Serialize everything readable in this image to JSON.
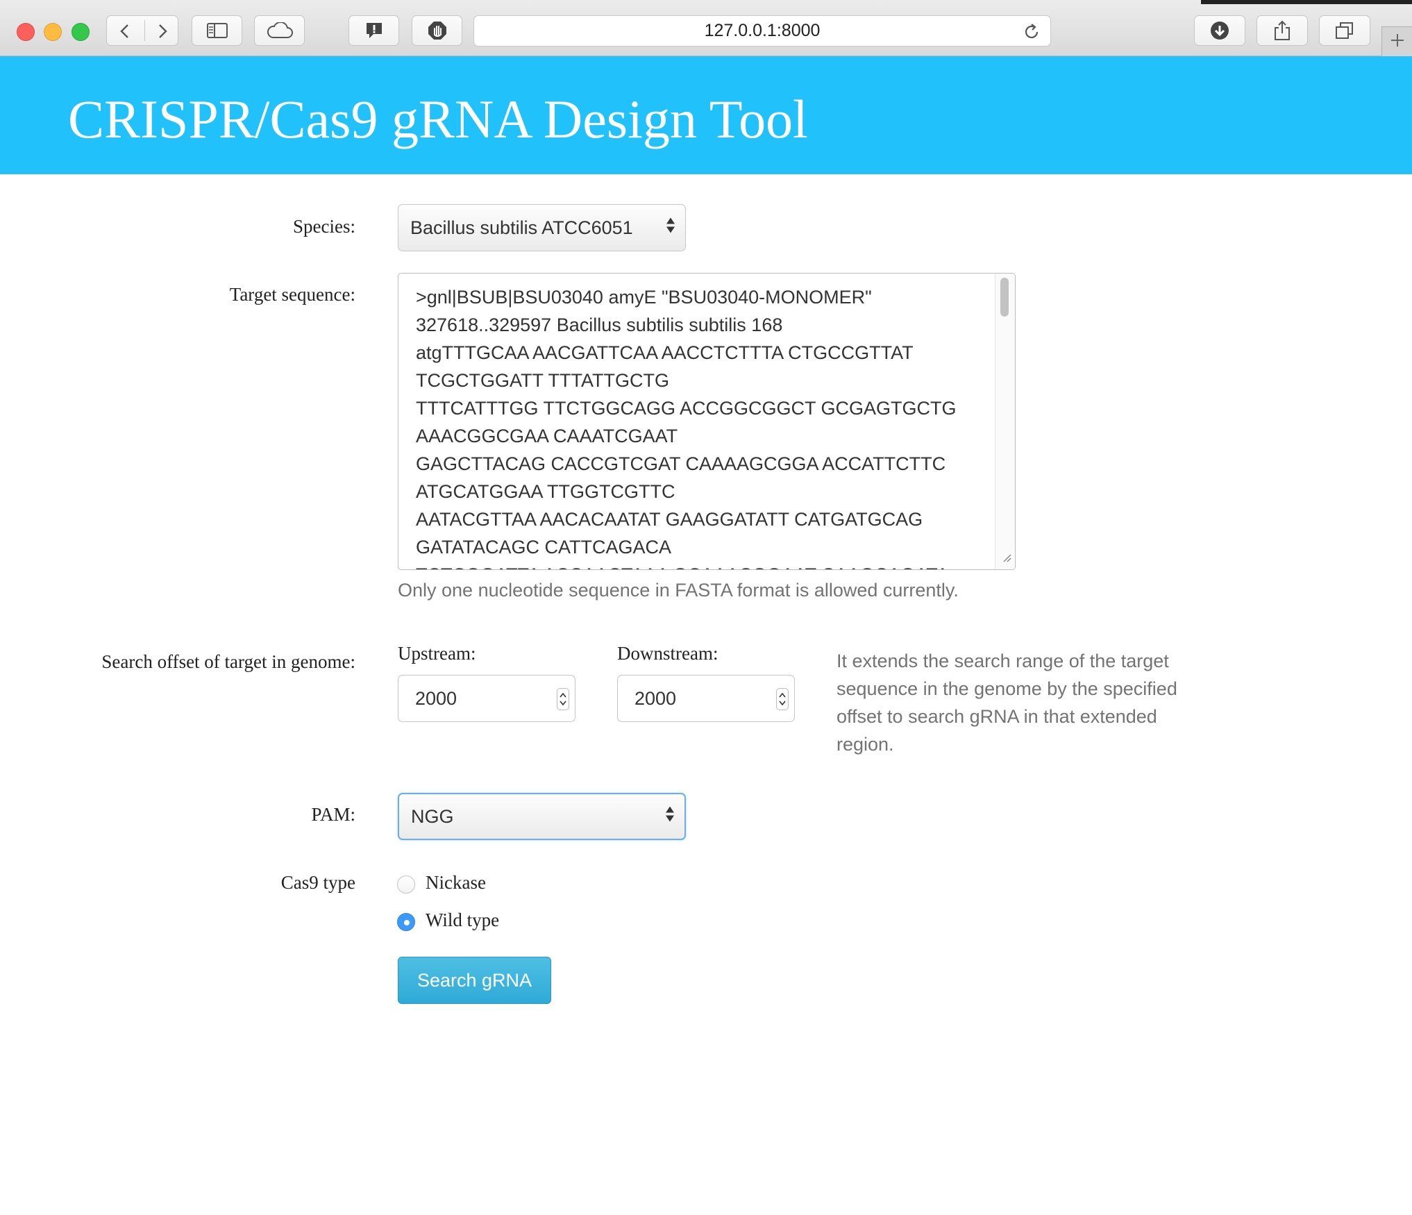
{
  "browser": {
    "url": "127.0.0.1:8000"
  },
  "header": {
    "title": "CRISPR/Cas9 gRNA Design Tool"
  },
  "form": {
    "species": {
      "label": "Species:",
      "selected": "Bacillus subtilis ATCC6051"
    },
    "target_sequence": {
      "label": "Target sequence:",
      "lines": [
        ">gnl|BSUB|BSU03040 amyE \"BSU03040-MONOMER\"",
        "327618..329597 Bacillus subtilis subtilis 168",
        "atgTTTGCAA AACGATTCAA AACCTCTTTA CTGCCGTTAT",
        "TCGCTGGATT TTTATTGCTG",
        "TTTCATTTGG TTCTGGCAGG ACCGGCGGCT GCGAGTGCTG",
        "AAACGGCGAA CAAATCGAAT",
        "GAGCTTACAG CACCGTCGAT CAAAAGCGGA ACCATTCTTC",
        "ATGCATGGAA TTGGTCGTTC",
        "AATACGTTAA AACACAATAT GAAGGATATT CATGATGCAG",
        "GATATACAGC CATTCAGACA",
        "TCTCGGATTA ACCAACTAAA GCAAACGGAAT CAAGCAGATA"
      ],
      "help": "Only one nucleotide sequence in FASTA format is allowed currently."
    },
    "search_offset": {
      "label": "Search offset of target in genome:",
      "upstream_label": "Upstream:",
      "upstream_value": "2000",
      "downstream_label": "Downstream:",
      "downstream_value": "2000",
      "help_lines": [
        "It extends the search range of the target",
        "sequence in the genome by the specified",
        "offset to search gRNA in that extended",
        "region."
      ]
    },
    "pam": {
      "label": "PAM:",
      "selected": "NGG"
    },
    "cas9_type": {
      "label": "Cas9 type",
      "options": [
        "Nickase",
        "Wild type"
      ],
      "selected": "Wild type"
    },
    "submit_label": "Search gRNA"
  },
  "icons": [
    "back-icon",
    "forward-icon",
    "sidebar-icon",
    "cloud-icon",
    "message-icon",
    "hand-stop-icon",
    "reload-icon",
    "download-icon",
    "share-icon",
    "tabs-icon",
    "plus-icon",
    "select-arrows-icon",
    "stepper-icon",
    "resize-handle-icon"
  ],
  "colors": {
    "header_bg": "#21c1fc",
    "button_bg": "#2eaad8",
    "radio_selected": "#3b99fc"
  }
}
